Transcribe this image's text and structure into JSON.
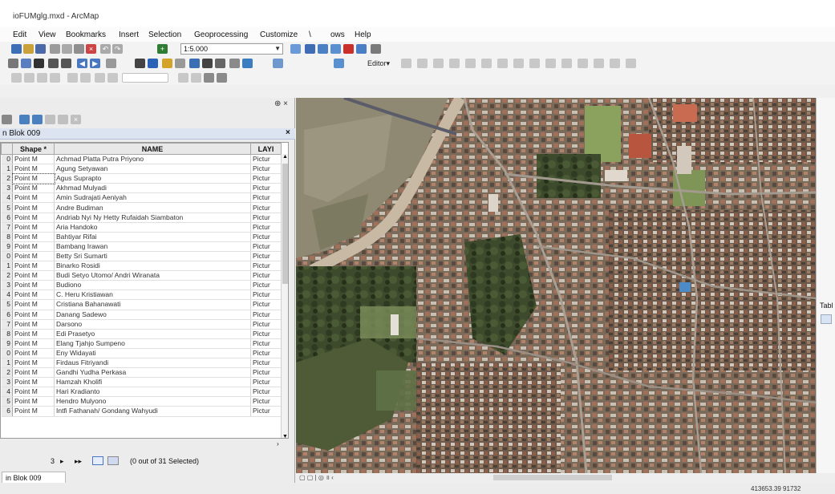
{
  "window": {
    "title": "ioFUMglg.mxd - ArcMap"
  },
  "menu": [
    "Edit",
    "View",
    "Bookmarks",
    "Insert",
    "Selection",
    "Geoprocessing",
    "Customize",
    "\\",
    "ows",
    "Help"
  ],
  "toolbar": {
    "scale": "1:5.000",
    "editor_label": "Editor▾"
  },
  "table_window": {
    "title": "n Blok 009",
    "columns": [
      "Shape *",
      "NAME",
      "LAYI"
    ],
    "rows": [
      {
        "idx": "0",
        "shape": "Point M",
        "name": "Achmad Platta Putra Priyono",
        "layer": "Pictur"
      },
      {
        "idx": "1",
        "shape": "Point M",
        "name": "Agung Setyawan",
        "layer": "Pictur"
      },
      {
        "idx": "2",
        "shape": "Point M",
        "name": "Agus Suprapto",
        "layer": "Pictur"
      },
      {
        "idx": "3",
        "shape": "Point M",
        "name": "Akhmad Mulyadi",
        "layer": "Pictur"
      },
      {
        "idx": "4",
        "shape": "Point M",
        "name": "Amin Sudrajati Aeniyah",
        "layer": "Pictur"
      },
      {
        "idx": "5",
        "shape": "Point M",
        "name": "Andre Budiman",
        "layer": "Pictur"
      },
      {
        "idx": "6",
        "shape": "Point M",
        "name": "Andriab Nyi Ny Hetty Rufaidah Siambaton",
        "layer": "Pictur"
      },
      {
        "idx": "7",
        "shape": "Point M",
        "name": "Aria Handoko",
        "layer": "Pictur"
      },
      {
        "idx": "8",
        "shape": "Point M",
        "name": "Bahtiyar Rifai",
        "layer": "Pictur"
      },
      {
        "idx": "9",
        "shape": "Point M",
        "name": "Bambang Irawan",
        "layer": "Pictur"
      },
      {
        "idx": "0",
        "shape": "Point M",
        "name": "Betty Sri Sumarti",
        "layer": "Pictur"
      },
      {
        "idx": "1",
        "shape": "Point M",
        "name": "Binarko Rosidi",
        "layer": "Pictur"
      },
      {
        "idx": "2",
        "shape": "Point M",
        "name": "Budi Setyo Utomo/ Andri Wiranata",
        "layer": "Pictur"
      },
      {
        "idx": "3",
        "shape": "Point M",
        "name": "Budiono",
        "layer": "Pictur"
      },
      {
        "idx": "4",
        "shape": "Point M",
        "name": "C. Heru Kristiawan",
        "layer": "Pictur"
      },
      {
        "idx": "5",
        "shape": "Point M",
        "name": "Cristiana Bahanawati",
        "layer": "Pictur"
      },
      {
        "idx": "6",
        "shape": "Point M",
        "name": "Danang Sadewo",
        "layer": "Pictur"
      },
      {
        "idx": "7",
        "shape": "Point M",
        "name": "Darsono",
        "layer": "Pictur"
      },
      {
        "idx": "8",
        "shape": "Point M",
        "name": "Edi Prasetyo",
        "layer": "Pictur"
      },
      {
        "idx": "9",
        "shape": "Point M",
        "name": "Elang Tjahjo Sumpeno",
        "layer": "Pictur"
      },
      {
        "idx": "0",
        "shape": "Point M",
        "name": "Eny Widayati",
        "layer": "Pictur"
      },
      {
        "idx": "1",
        "shape": "Point M",
        "name": "Firdaus Fitriyandi",
        "layer": "Pictur"
      },
      {
        "idx": "2",
        "shape": "Point M",
        "name": "Gandhi Yudha Perkasa",
        "layer": "Pictur"
      },
      {
        "idx": "3",
        "shape": "Point M",
        "name": "Hamzah Kholifi",
        "layer": "Pictur"
      },
      {
        "idx": "4",
        "shape": "Point M",
        "name": "Hari Kradianto",
        "layer": "Pictur"
      },
      {
        "idx": "5",
        "shape": "Point M",
        "name": "Hendro Mulyono",
        "layer": "Pictur"
      },
      {
        "idx": "6",
        "shape": "Point M",
        "name": "Intfi Fathanah/ Gondang Wahyudi",
        "layer": "Pictur"
      }
    ],
    "nav": {
      "record": "3",
      "status": "(0 out of 31 Selected)"
    },
    "bottom_tab": "in Blok 009"
  },
  "right_panel": {
    "label": "Tabl"
  },
  "statusbar": {
    "coords": "413653.39 91732"
  },
  "colors": {
    "tab_header": "#dbe4f0",
    "map_base": "#6e5a48",
    "selected_nav": "#4a74c8"
  }
}
